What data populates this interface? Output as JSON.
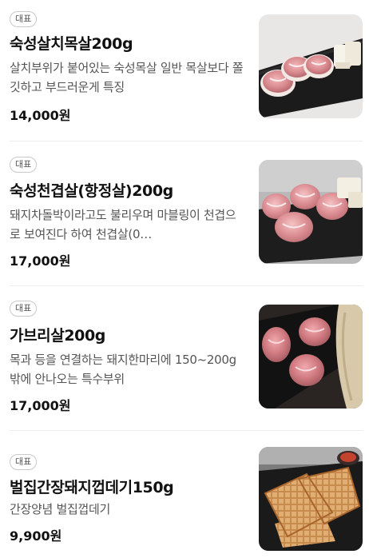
{
  "menu": {
    "items": [
      {
        "badge": "대표",
        "name": "숙성살치목살200g",
        "description": "살치부위가 붙어있는 숙성목살 일반 목살보다 쫄깃하고 부드러운게 특징",
        "price": "14,000원",
        "image": "pork-neck-with-tofu-on-black-plate"
      },
      {
        "badge": "대표",
        "name": "숙성천겹살(항정살)200g",
        "description": "돼지차돌박이라고도 불리우며 마블링이 천겹으로 보여진다 하여 천겹살(0…",
        "price": "17,000원",
        "image": "rolled-pork-jowl-on-black-plate"
      },
      {
        "badge": "대표",
        "name": "가브리살200g",
        "description": "목과 등을 연결하는 돼지한마리에 150~200g밖에 안나오는 특수부위",
        "price": "17,000원",
        "image": "pork-pieces-with-bamboo-shoot"
      },
      {
        "badge": "대표",
        "name": "벌집간장돼지껍데기150g",
        "description": "간장양념 벌집껍데기",
        "price": "9,900원",
        "image": "honeycomb-soy-pork-skin"
      }
    ]
  }
}
